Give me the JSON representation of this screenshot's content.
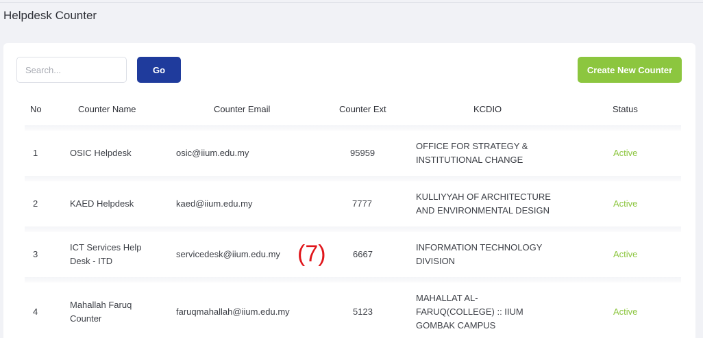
{
  "page": {
    "title": "Helpdesk Counter"
  },
  "toolbar": {
    "search_placeholder": "Search...",
    "search_value": "",
    "go_label": "Go",
    "create_label": "Create New Counter"
  },
  "table": {
    "headers": [
      "No",
      "Counter Name",
      "Counter Email",
      "Counter Ext",
      "KCDIO",
      "Status"
    ],
    "rows": [
      {
        "no": "1",
        "name": [
          "OSIC Helpdesk"
        ],
        "email": "osic@iium.edu.my",
        "ext": "95959",
        "kcdio": [
          "OFFICE FOR STRATEGY &",
          "INSTITUTIONAL CHANGE"
        ],
        "status": "Active"
      },
      {
        "no": "2",
        "name": [
          "KAED Helpdesk"
        ],
        "email": "kaed@iium.edu.my",
        "ext": "7777",
        "kcdio": [
          "KULLIYYAH OF ARCHITECTURE",
          "AND ENVIRONMENTAL DESIGN"
        ],
        "status": "Active"
      },
      {
        "no": "3",
        "name": [
          "ICT Services Help",
          "Desk - ITD"
        ],
        "email": "servicedesk@iium.edu.my",
        "ext": "6667",
        "kcdio": [
          "INFORMATION TECHNOLOGY",
          "DIVISION"
        ],
        "status": "Active"
      },
      {
        "no": "4",
        "name": [
          "Mahallah Faruq",
          "Counter"
        ],
        "email": "faruqmahallah@iium.edu.my",
        "ext": "5123",
        "kcdio": [
          "MAHALLAT AL-",
          "FARUQ(COLLEGE) :: IIUM",
          "GOMBAK CAMPUS"
        ],
        "status": "Active"
      }
    ]
  },
  "annotation": {
    "label": "(7)",
    "color": "#e0161b"
  },
  "colors": {
    "primary": "#1f3b9c",
    "success": "#8cc63f"
  }
}
